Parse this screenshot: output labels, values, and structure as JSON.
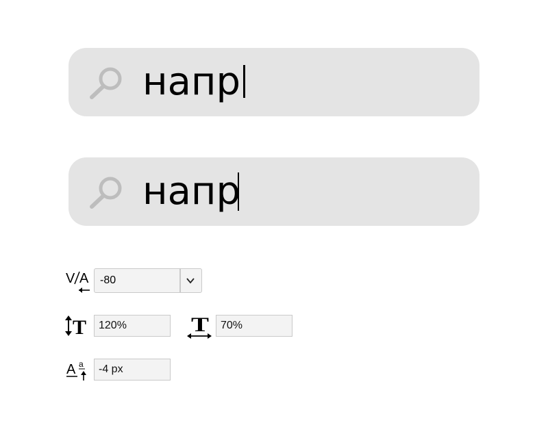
{
  "search_fields": [
    {
      "query": "напр",
      "caret": "after-glyph"
    },
    {
      "query": "напр",
      "caret": "overlapping-last-glyph"
    }
  ],
  "typography": {
    "tracking": {
      "icon": "tracking-icon",
      "value": "-80"
    },
    "line_height": {
      "icon": "line-height-icon",
      "value": "120%"
    },
    "horizontal_scale": {
      "icon": "horizontal-scale-icon",
      "value": "70%"
    },
    "baseline_shift": {
      "icon": "baseline-shift-icon",
      "value": "-4 px"
    }
  },
  "colors": {
    "search_bg": "#e4e4e4",
    "search_icon": "#bdbdbd",
    "field_bg": "#f3f3f3",
    "field_border": "#c9c9c9"
  }
}
